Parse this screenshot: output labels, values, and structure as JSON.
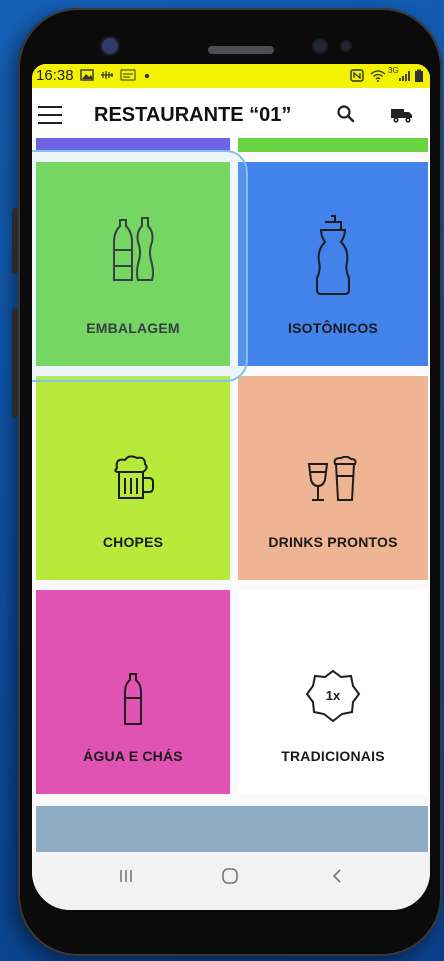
{
  "status_bar": {
    "time": "16:38",
    "network": "3G"
  },
  "app_bar": {
    "title": "RESTAURANTE “01”",
    "menu_icon": "hamburger-menu-icon",
    "search_icon": "search-icon",
    "cart_icon": "delivery-truck-icon"
  },
  "categories": [
    {
      "label": "EMBALAGEM",
      "color": "#6ad342",
      "icon": "bottles-icon",
      "selected": true
    },
    {
      "label": "ISOTÔNICOS",
      "color": "#4282ea",
      "icon": "sport-bottle-icon"
    },
    {
      "label": "CHOPES",
      "color": "#b7ea3a",
      "icon": "beer-mug-icon"
    },
    {
      "label": "DRINKS PRONTOS",
      "color": "#efb493",
      "icon": "drink-glasses-icon"
    },
    {
      "label": "ÁGUA E CHÁS",
      "color": "#e053b3",
      "icon": "water-bottle-icon"
    },
    {
      "label": "TRADICIONAIS",
      "color": "#ffffff",
      "icon": "badge-1x-icon",
      "badge": "1x"
    }
  ],
  "colors": {
    "partial_top_left": "#6e63e6",
    "partial_top_right": "#6ad342",
    "partial_bottom": "#8eacc4",
    "status_bar": "#f3f200"
  },
  "nav_bar": {
    "recents": "recents-icon",
    "home": "home-icon",
    "back": "back-icon"
  }
}
